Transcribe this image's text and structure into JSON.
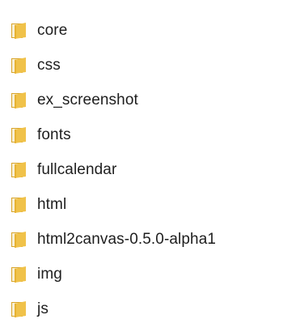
{
  "folders": [
    {
      "label": "core",
      "icon": "folder-icon"
    },
    {
      "label": "css",
      "icon": "folder-icon"
    },
    {
      "label": "ex_screenshot",
      "icon": "folder-icon"
    },
    {
      "label": "fonts",
      "icon": "folder-icon"
    },
    {
      "label": "fullcalendar",
      "icon": "folder-icon"
    },
    {
      "label": "html",
      "icon": "folder-icon"
    },
    {
      "label": "html2canvas-0.5.0-alpha1",
      "icon": "folder-icon"
    },
    {
      "label": "img",
      "icon": "folder-icon"
    },
    {
      "label": "js",
      "icon": "folder-icon"
    }
  ],
  "colors": {
    "folder_body": "#f0c24a",
    "folder_front": "#e6b233",
    "folder_paper": "#f7f0d8",
    "text": "#1e1e1e",
    "background": "#ffffff"
  }
}
